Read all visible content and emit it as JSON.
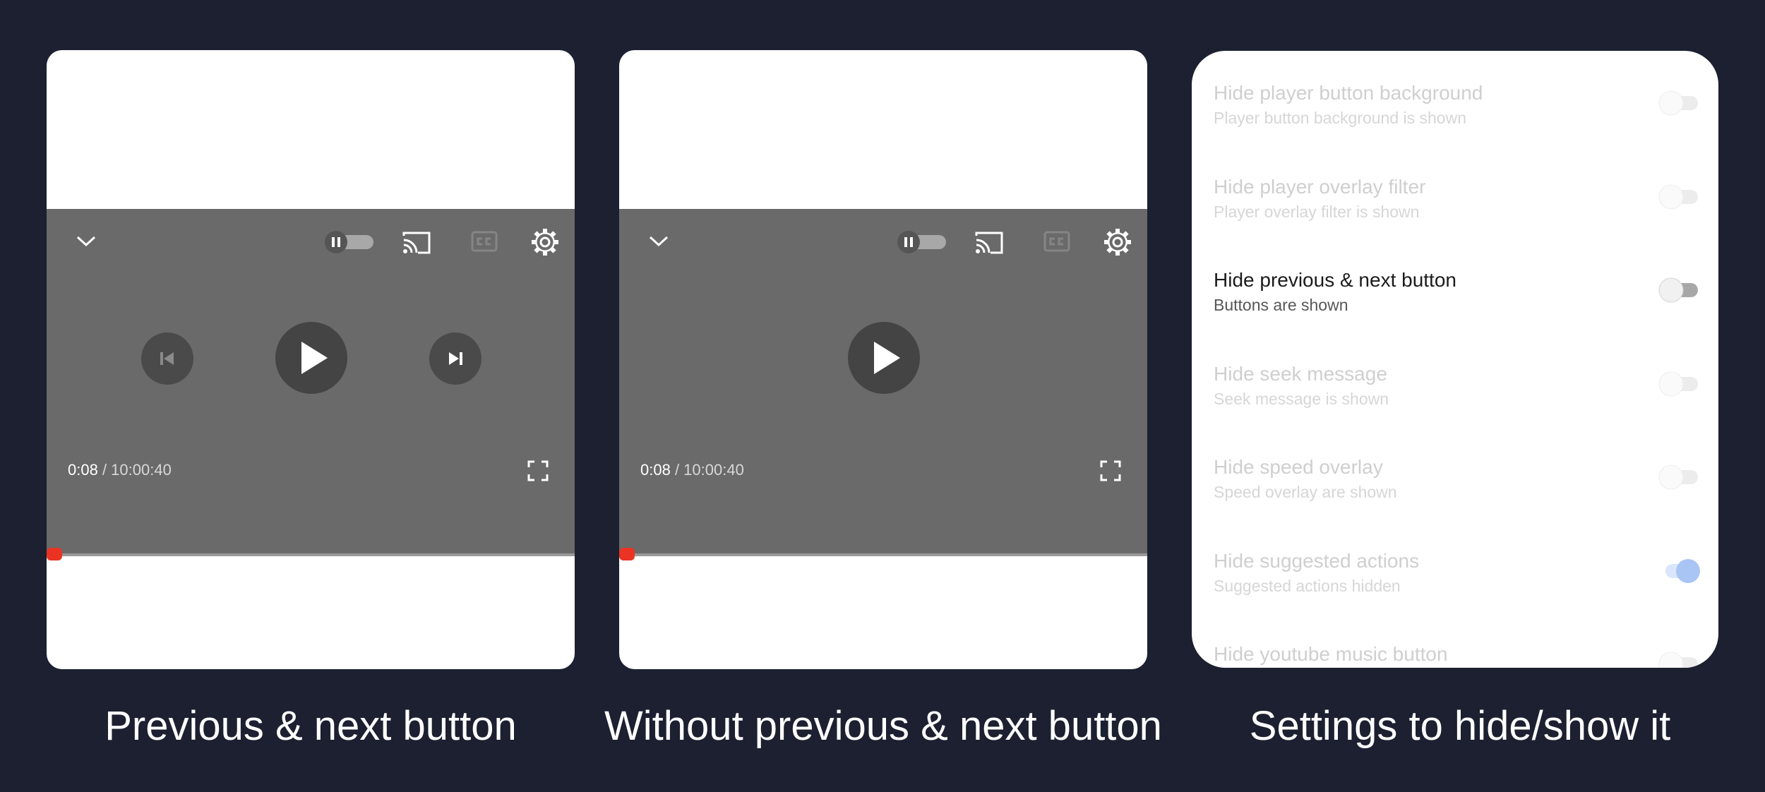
{
  "captions": {
    "left": "Previous & next button",
    "middle": "Without previous & next button",
    "right": "Settings to hide/show it"
  },
  "player": {
    "current_time": "0:08",
    "separator": " / ",
    "duration": "10:00:40",
    "progress_fraction": 0.0
  },
  "icons": [
    "chevron-down-icon",
    "autoplay-toggle-icon",
    "cast-icon",
    "captions-icon",
    "gear-icon",
    "skip-previous-icon",
    "play-icon",
    "skip-next-icon",
    "fullscreen-icon"
  ],
  "settings": [
    {
      "title": "Hide player button background",
      "subtitle": "Player button background is shown",
      "on": false,
      "active": false
    },
    {
      "title": "Hide player overlay filter",
      "subtitle": "Player overlay filter is shown",
      "on": false,
      "active": false
    },
    {
      "title": "Hide previous & next button",
      "subtitle": "Buttons are shown",
      "on": false,
      "active": true
    },
    {
      "title": "Hide seek message",
      "subtitle": "Seek message is shown",
      "on": false,
      "active": false
    },
    {
      "title": "Hide speed overlay",
      "subtitle": "Speed overlay are shown",
      "on": false,
      "active": false
    },
    {
      "title": "Hide suggested actions",
      "subtitle": "Suggested actions hidden",
      "on": true,
      "active": false
    },
    {
      "title": "Hide youtube music button",
      "subtitle": "",
      "on": false,
      "active": false
    }
  ],
  "colors": {
    "background": "#1c2030",
    "player": "#6a6a6a",
    "progress": "#ea3323",
    "switch_on": "#a9c5f3"
  }
}
